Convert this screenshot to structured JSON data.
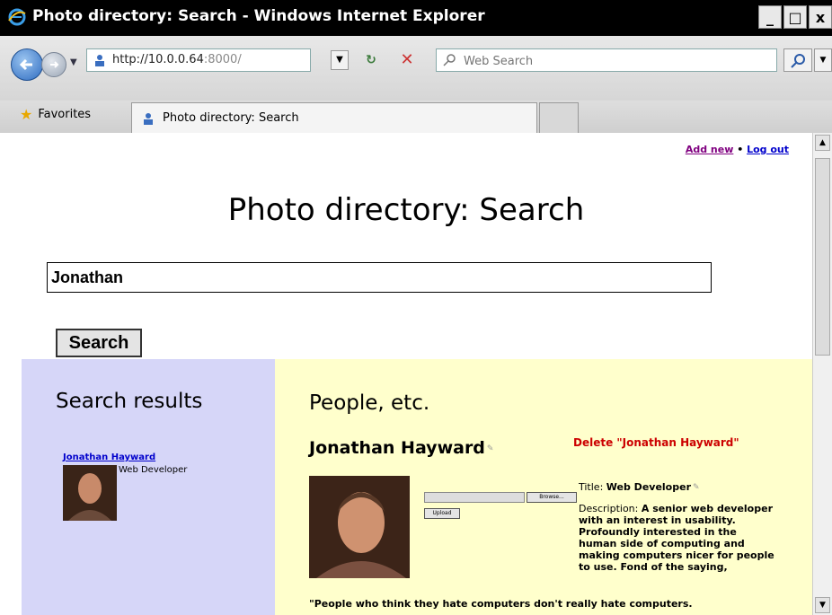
{
  "window": {
    "title": "Photo directory: Search - Windows Internet Explorer",
    "min_label": "_",
    "max_label": "□",
    "close_label": "x"
  },
  "nav": {
    "url_host": "http://10.0.0.64",
    "url_rest": ":8000/",
    "search_placeholder": "Web Search",
    "dropdown_glyph": "▼",
    "refresh_glyph": "↻",
    "stop_glyph": "✕"
  },
  "favbar": {
    "favorites_label": "Favorites",
    "tab_label": "Photo directory: Search"
  },
  "page": {
    "add_new": "Add new",
    "separator": "•",
    "log_out": "Log out",
    "title": "Photo directory: Search",
    "query_value": "Jonathan",
    "search_button": "Search"
  },
  "results": {
    "heading": "Search results",
    "items": [
      {
        "name": "Jonathan Hayward",
        "title": "Web Developer"
      }
    ]
  },
  "people": {
    "heading": "People, etc.",
    "name": "Jonathan Hayward",
    "edit_glyph": "✎",
    "delete_label": "Delete \"Jonathan Hayward\"",
    "browse_label": "Browse...",
    "upload_label": "Upload",
    "title_label": "Title:",
    "title_value": "Web Developer",
    "desc_label": "Description:",
    "desc_value": "A senior web developer with an interest in usability. Profoundly interested in the human side of computing and making computers nicer for people to use. Fond of the saying,",
    "quote": "\"People who think they hate computers don't really hate computers."
  },
  "colors": {
    "results_bg": "#d6d6f8",
    "people_bg": "#ffffcc",
    "delete_red": "#c00",
    "link_blue": "#00c",
    "visited_purple": "#800080"
  }
}
